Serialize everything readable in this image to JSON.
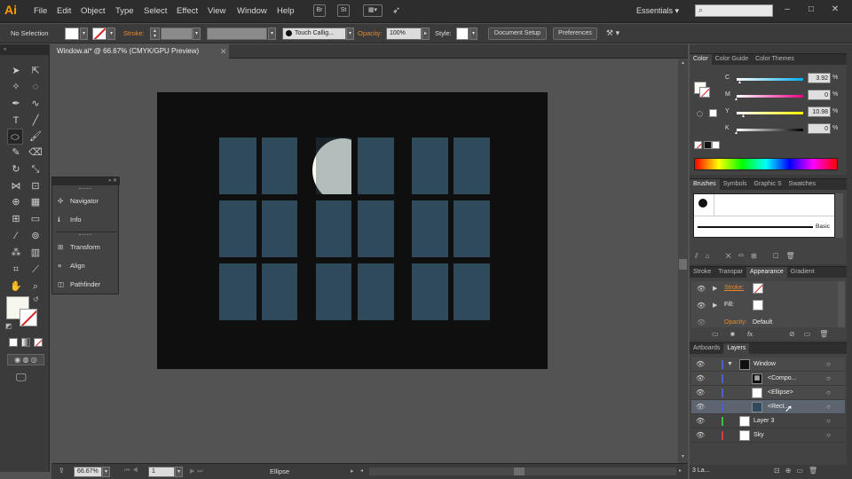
{
  "app": {
    "logo": "Ai"
  },
  "menu": [
    "File",
    "Edit",
    "Object",
    "Type",
    "Select",
    "Effect",
    "View",
    "Window",
    "Help"
  ],
  "menubar_buttons": [
    "Br",
    "St"
  ],
  "workspace": "Essentials",
  "window_controls": [
    "–",
    "□",
    "✕"
  ],
  "control_bar": {
    "selection": "No Selection",
    "stroke_label": "Stroke:",
    "brush": "Touch Callig...",
    "opacity_label": "Opacity:",
    "opacity_value": "100%",
    "style_label": "Style:",
    "document_setup": "Document Setup",
    "preferences": "Preferences"
  },
  "document": {
    "tab_title": "Window.ai* @ 66.67% (CMYK/GPU Preview)",
    "close": "✕"
  },
  "float_panel": {
    "items": [
      {
        "icon": "✣",
        "label": "Navigator"
      },
      {
        "icon": "ℹ",
        "label": "Info"
      },
      {
        "icon": "⊞",
        "label": "Transform"
      },
      {
        "icon": "≡",
        "label": "Align"
      },
      {
        "icon": "◫",
        "label": "Pathfinder"
      }
    ]
  },
  "color_panel": {
    "tabs": [
      "Color",
      "Color Guide",
      "Color Themes"
    ],
    "channels": [
      {
        "name": "C",
        "value": "3.92",
        "unit": "%",
        "level": 0.04
      },
      {
        "name": "M",
        "value": "0",
        "unit": "%",
        "level": 0.0
      },
      {
        "name": "Y",
        "value": "10.98",
        "unit": "%",
        "level": 0.11
      },
      {
        "name": "K",
        "value": "0",
        "unit": "%",
        "level": 0.0
      }
    ]
  },
  "brushes_panel": {
    "tabs": [
      "Brushes",
      "Symbols",
      "Graphic S",
      "Swatches"
    ],
    "brush_name": "Basic"
  },
  "appearance_panel": {
    "tabs": [
      "Stroke",
      "Transpar",
      "Appearance",
      "Gradient"
    ],
    "rows": [
      {
        "label": "Stroke:"
      },
      {
        "label": "Fill:"
      },
      {
        "label": "Opacity:",
        "value": "Default"
      }
    ],
    "fx": "fx."
  },
  "layers_panel": {
    "tabs": [
      "Artboards",
      "Layers"
    ],
    "rows": [
      {
        "name": "Window",
        "color": "#4f5fd0"
      },
      {
        "name": "<Compo...",
        "color": "#4f5fd0"
      },
      {
        "name": "<Ellipse>",
        "color": "#4f5fd0"
      },
      {
        "name": "<Rect...",
        "color": "#4f5fd0"
      },
      {
        "name": "Layer 3",
        "color": "#3fbf3f"
      },
      {
        "name": "Sky",
        "color": "#d04040"
      }
    ],
    "footer": "3 La..."
  },
  "status_bar": {
    "zoom": "66.67%",
    "artboard": "1",
    "tool": "Ellipse"
  },
  "colors": {
    "artboard_bg": "#0f0f0f",
    "pane": "#2e4a5b",
    "moon": "#fbfbf0",
    "accent_orange": "#e8862a"
  }
}
